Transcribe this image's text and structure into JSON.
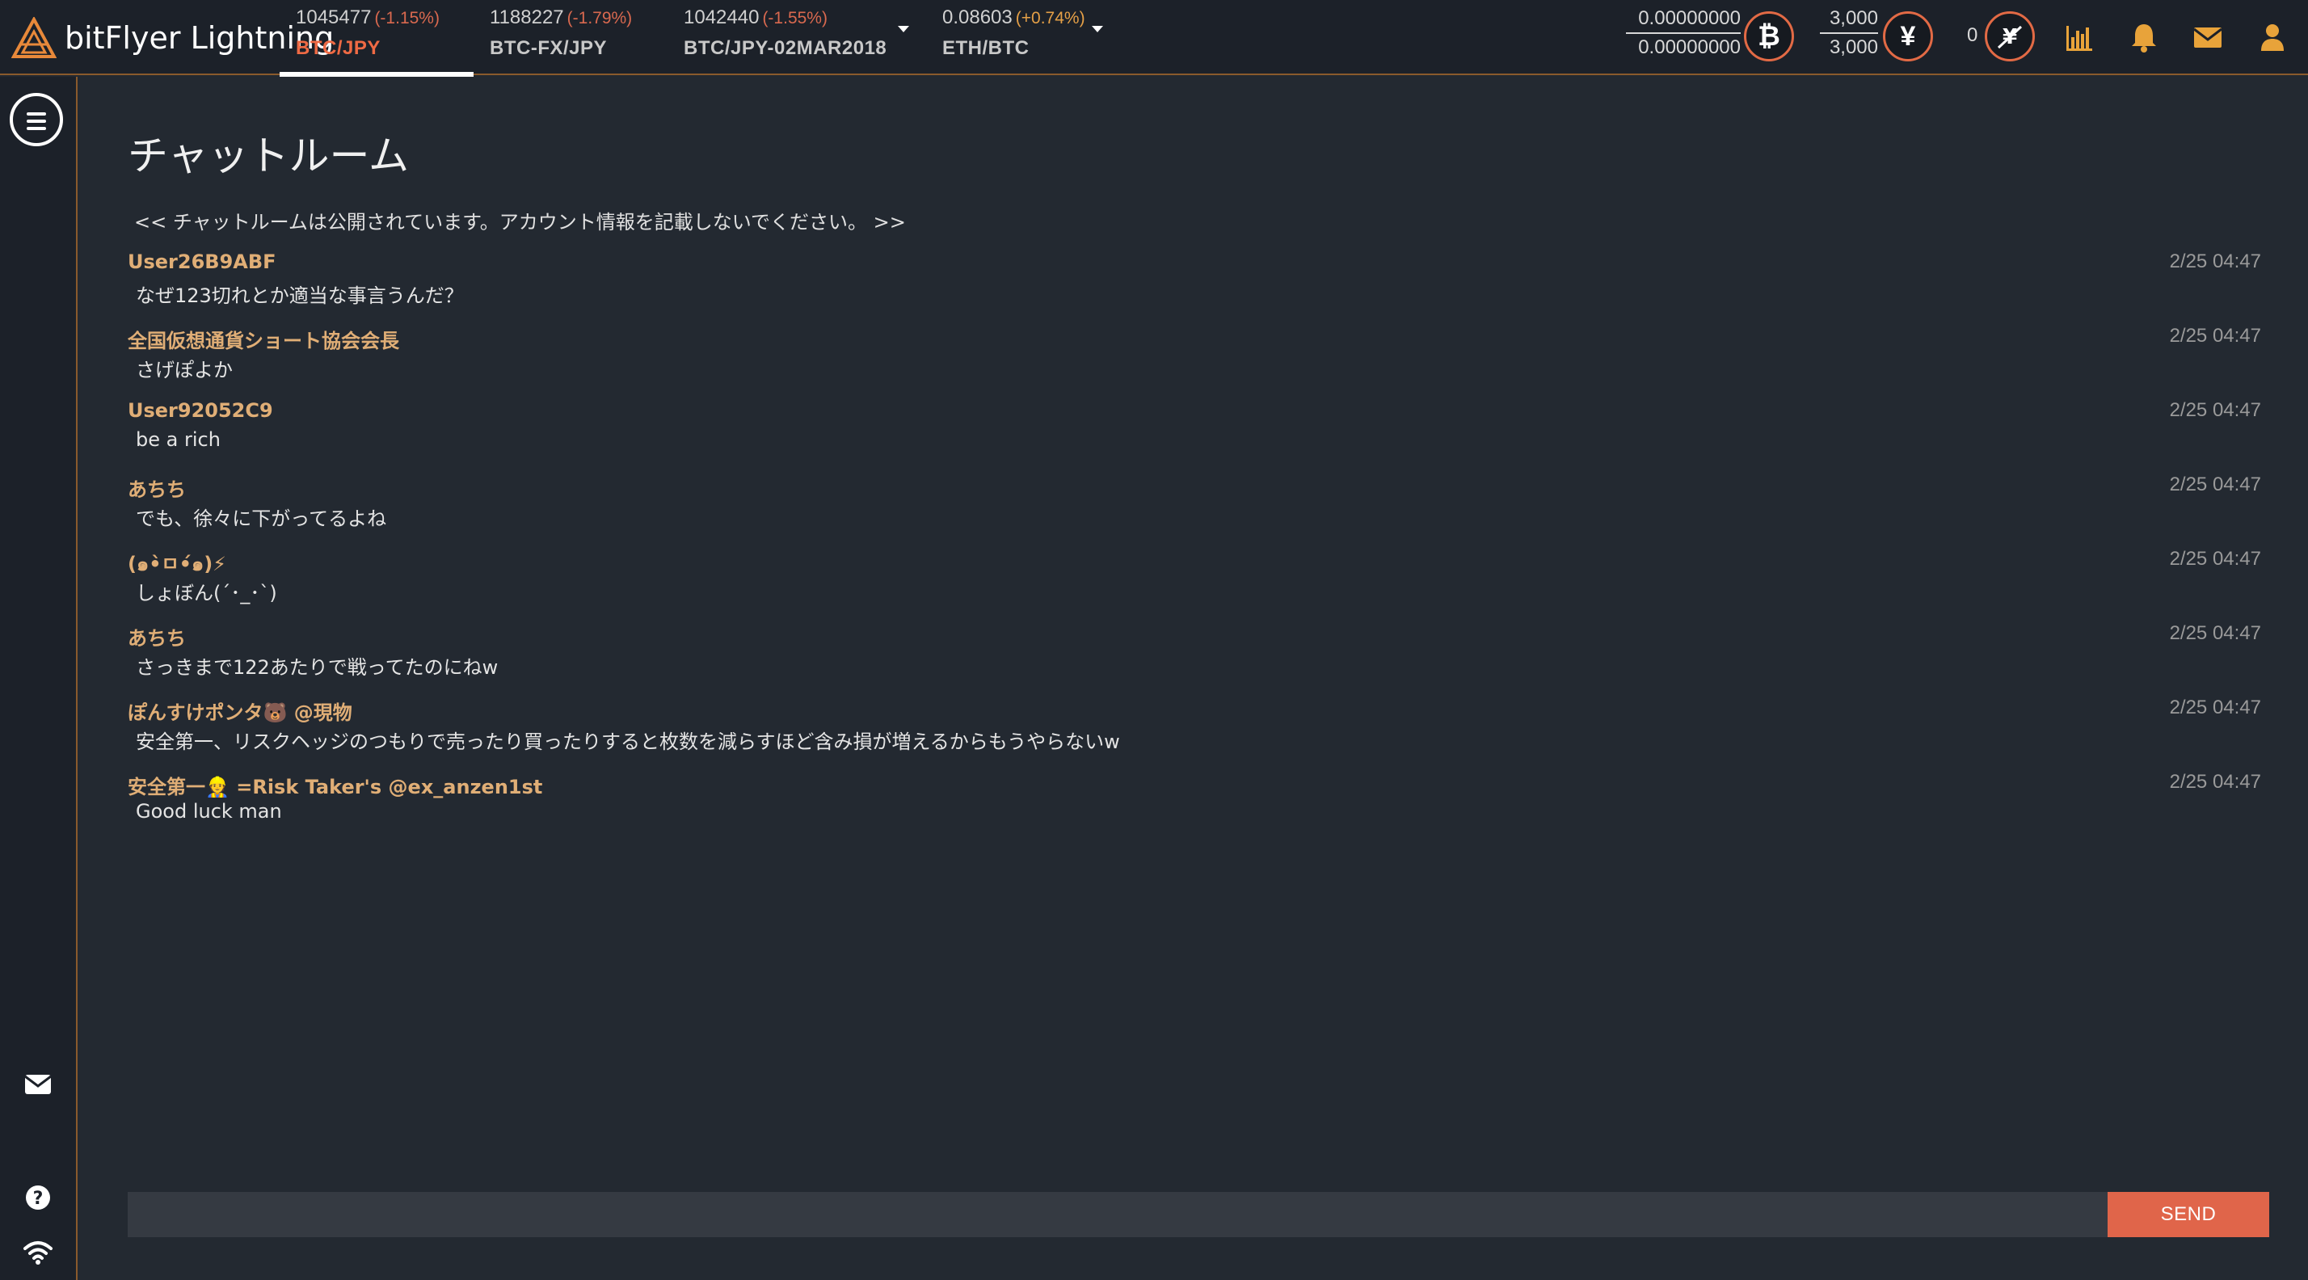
{
  "header": {
    "logo_text": "bitFlyer Lightning",
    "tickers": [
      {
        "price": "1045477",
        "change": "(-1.15%)",
        "pair": "BTC/JPY",
        "active": true
      },
      {
        "price": "1188227",
        "change": "(-1.79%)",
        "pair": "BTC-FX/JPY",
        "active": false
      },
      {
        "price": "1042440",
        "change": "(-1.55%)",
        "pair": "BTC/JPY-02MAR2018",
        "active": false
      },
      {
        "price": "0.08603",
        "change": "(+0.74%)",
        "pair": "ETH/BTC",
        "active": false
      }
    ],
    "btc_balance": {
      "available": "0.00000000",
      "total": "0.00000000"
    },
    "jpy_balance": {
      "available": "3,000",
      "total": "3,000"
    },
    "margin_count": "0",
    "btc_symbol": "₿",
    "jpy_symbol": "¥"
  },
  "colors": {
    "accent": "#e0654a",
    "username": "#e0ae76",
    "icon": "#e8a33a",
    "negative": "#d9694f"
  },
  "icons": {
    "top": [
      "chart-icon",
      "bell-icon",
      "mail-icon",
      "user-icon"
    ],
    "sidebar": [
      "menu-icon",
      "mail-icon",
      "help-icon",
      "wifi-icon"
    ]
  },
  "chat": {
    "title": "チャットルーム",
    "notice": "<< チャットルームは公開されています。アカウント情報を記載しないでください。 >>",
    "messages": [
      {
        "user": "User26B9ABF",
        "text": "なぜ123切れとか適当な事言うんだ？",
        "time": "2/25 04:47"
      },
      {
        "user": "全国仮想通貨ショート協会会長",
        "text": "さげぽよか",
        "time": "2/25 04:47"
      },
      {
        "user": "User92052C9",
        "text": "be a rich",
        "time": "2/25 04:47"
      },
      {
        "user": "あちち",
        "text": "でも、徐々に下がってるよね",
        "time": "2/25 04:47"
      },
      {
        "user": "(๑•̀ㅁ•́๑)⚡",
        "text": "しょぼん(´･_･`)",
        "time": "2/25 04:47"
      },
      {
        "user": "あちち",
        "text": "さっきまで122あたりで戦ってたのにねw",
        "time": "2/25 04:47"
      },
      {
        "user": "ぽんすけポンタ🐻 @現物",
        "text": "安全第一、リスクヘッジのつもりで売ったり買ったりすると枚数を減らすほど含み損が増えるからもうやらないw",
        "time": "2/25 04:47"
      },
      {
        "user": "安全第一👷 =Risk Taker's @ex_anzen1st",
        "text": "Good luck man",
        "time": "2/25 04:47"
      }
    ],
    "input_value": "",
    "send_label": "SEND"
  }
}
